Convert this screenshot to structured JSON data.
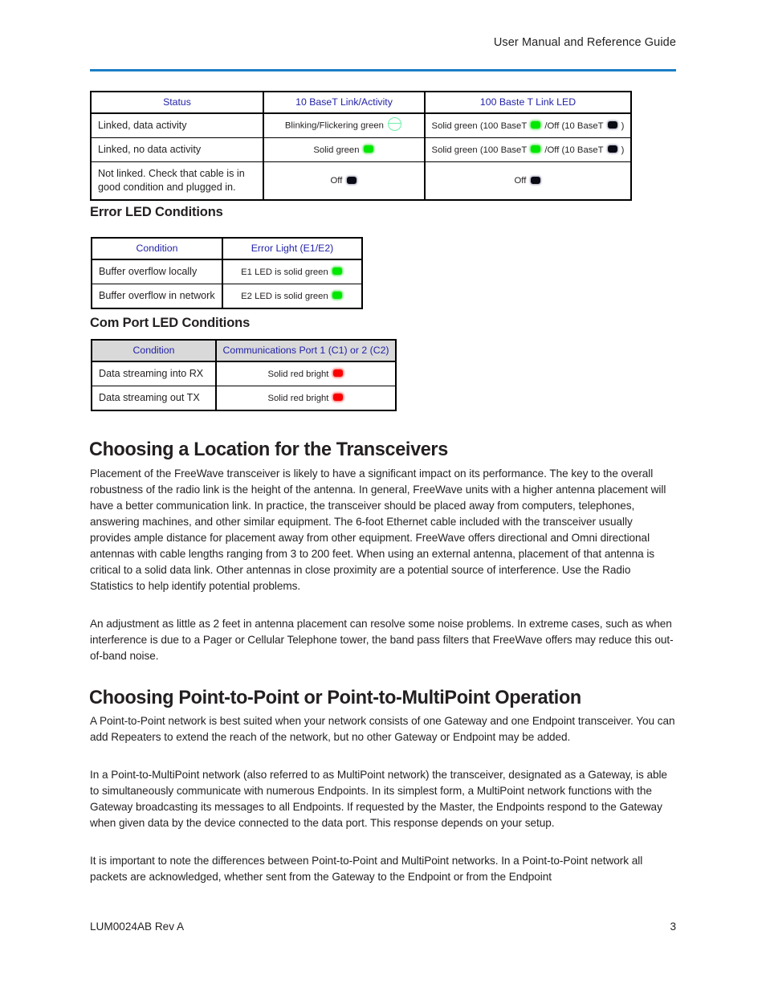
{
  "header": {
    "title": "User Manual and Reference Guide",
    "rule_color": "#1b7fc4"
  },
  "tables": {
    "ethernet_led": {
      "headers": [
        "Status",
        "10 BaseT Link/Activity",
        "100 Baste T Link LED"
      ],
      "rows": [
        {
          "status": "Linked, data activity",
          "baset10_text": "Blinking/Flickering green",
          "baset10_led": "blinking-green-led-icon",
          "baset100_text_a": "Solid green (100 BaseT",
          "baset100_led_a": "green-led-icon",
          "baset100_text_b": "/Off (10 BaseT",
          "baset100_led_b": "black-led-icon",
          "baset100_text_c": ")"
        },
        {
          "status": "Linked, no data activity",
          "baset10_text": "Solid green",
          "baset10_led": "green-led-icon",
          "baset100_text_a": "Solid green (100 BaseT",
          "baset100_led_a": "green-led-icon",
          "baset100_text_b": "/Off (10 BaseT",
          "baset100_led_b": "black-led-icon",
          "baset100_text_c": ")"
        },
        {
          "status": "Not linked. Check that cable is in good condition and plugged in.",
          "baset10_text": "Off",
          "baset10_led": "black-led-icon",
          "baset100_text_a": "Off",
          "baset100_led_a": "black-led-icon",
          "baset100_text_b": "",
          "baset100_led_b": "",
          "baset100_text_c": ""
        }
      ]
    },
    "error_led": {
      "heading": "Error LED Conditions",
      "headers": [
        "Condition",
        "Error Light (E1/E2)"
      ],
      "rows": [
        {
          "condition": "Buffer overflow locally",
          "light": "E1 LED is solid green",
          "led": "green-led-icon"
        },
        {
          "condition": "Buffer overflow in network",
          "light": "E2 LED is solid green",
          "led": "green-led-icon"
        }
      ]
    },
    "comport_led": {
      "heading": "Com Port LED Conditions",
      "headers": [
        "Condition",
        "Communications Port 1 (C1) or 2 (C2)"
      ],
      "header_shaded": true,
      "rows": [
        {
          "condition": "Data streaming into RX",
          "light": "Solid red bright",
          "led": "red-led-icon"
        },
        {
          "condition": "Data streaming out TX",
          "light": "Solid red bright",
          "led": "red-led-icon"
        }
      ]
    }
  },
  "sections": [
    {
      "heading": "Choosing a Location for the Transceivers",
      "paragraphs": [
        "Placement of the FreeWave transceiver is likely to have a significant impact on its performance. The key to the overall robustness of the radio link is the height of the antenna. In general, FreeWave units with a higher antenna placement will have a better communication link. In practice, the transceiver should be placed away from computers, telephones, answering machines, and other similar equipment. The 6-foot Ethernet cable included with the transceiver usually provides ample distance for placement away from other equipment. FreeWave  offers directional and Omni directional antennas with cable lengths ranging from 3 to 200 feet. When using an external antenna, placement of that antenna is critical to a solid data link. Other antennas in close proximity are a potential source of interference. Use the Radio Statistics to help identify potential problems.",
        "An adjustment as little as 2 feet in antenna placement can resolve some noise problems. In extreme cases, such as when interference is due to a Pager or Cellular Telephone tower, the band pass filters that FreeWave offers may reduce this out-of-band noise."
      ]
    },
    {
      "heading": "Choosing Point-to-Point or Point-to-MultiPoint Operation",
      "paragraphs": [
        "A Point-to-Point network is best suited when your network consists of one Gateway and one  Endpoint transceiver. You can add Repeaters to extend the reach of the network, but no other Gateway or Endpoint may be added.",
        "In a Point-to-MultiPoint network (also referred to as MultiPoint network) the transceiver, designated as a Gateway, is able to simultaneously communicate with numerous Endpoints. In its simplest form, a MultiPoint network functions with the Gateway broadcasting its messages to all Endpoints. If requested by the Master, the Endpoints respond to the Gateway when given data by the device connected to the data port. This response depends on your setup.",
        "It is important to note the differences between Point-to-Point and MultiPoint networks. In a Point-to-Point network all packets are acknowledged, whether sent from the Gateway to the Endpoint or from the Endpoint"
      ]
    }
  ],
  "footer": {
    "document_id": "LUM0024AB Rev A",
    "page_number": "3"
  },
  "colors": {
    "header_text_blue": "#2222a8",
    "rule_blue": "#1b7fc4",
    "led_green": "#00e800",
    "led_red": "#fb0000",
    "led_black": "#0a0a14",
    "shaded_header": "#d9d9d9"
  }
}
